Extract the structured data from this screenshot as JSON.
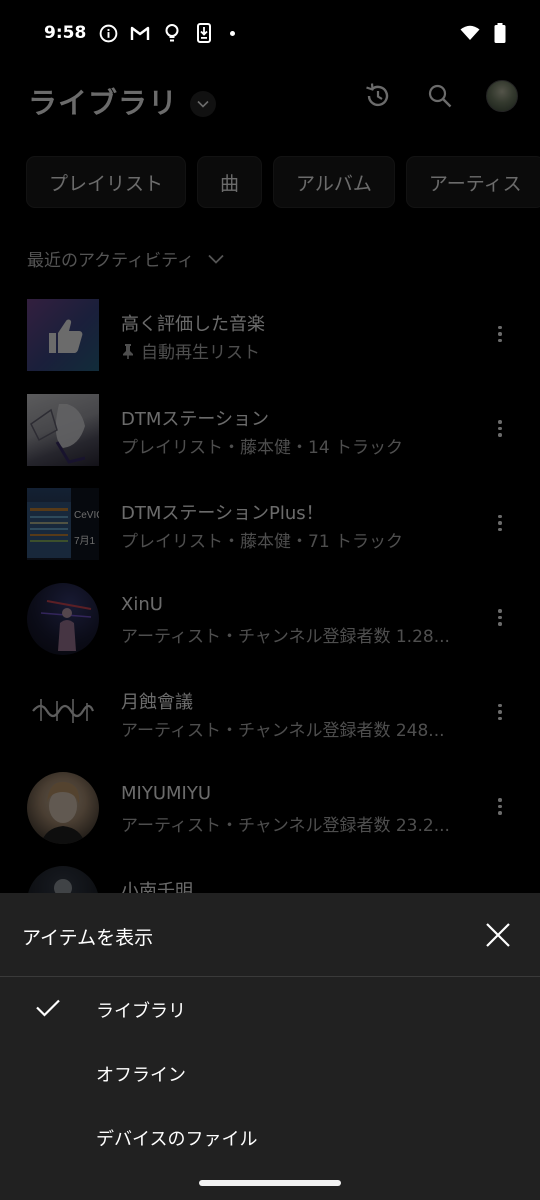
{
  "status_bar": {
    "time": "9:58",
    "icons": [
      "info-icon",
      "gmail-icon",
      "lightbulb-icon",
      "download-icon",
      "dot-icon",
      "wifi-icon",
      "battery-icon"
    ]
  },
  "header": {
    "title": "ライブラリ",
    "icons": [
      "history-icon",
      "search-icon",
      "account-avatar"
    ]
  },
  "chips": [
    "プレイリスト",
    "曲",
    "アルバム",
    "アーティス"
  ],
  "sort": {
    "label": "最近のアクティビティ"
  },
  "items": [
    {
      "title": "高く評価した音楽",
      "subtitle": "自動再生リスト",
      "thumb": "liked-thumb"
    },
    {
      "title": "DTMステーション",
      "subtitle": "プレイリスト・藤本健・14 トラック",
      "thumb": "playlist-thumb"
    },
    {
      "title": "DTMステーションPlus！",
      "subtitle": "プレイリスト・藤本健・71 トラック",
      "thumb": "playlist-thumb"
    },
    {
      "title": "XinU",
      "subtitle": "アーティスト・チャンネル登録者数 1.28...",
      "thumb": "artist-avatar"
    },
    {
      "title": "月蝕會議",
      "subtitle": "アーティスト・チャンネル登録者数 248...",
      "thumb": "artist-logo"
    },
    {
      "title": "MIYUMIYU",
      "subtitle": "アーティスト・チャンネル登録者数 23.2...",
      "thumb": "artist-avatar"
    },
    {
      "title": "小南千明",
      "subtitle": "",
      "thumb": "artist-avatar"
    }
  ],
  "sheet": {
    "title": "アイテムを表示",
    "options": [
      {
        "label": "ライブラリ",
        "selected": true
      },
      {
        "label": "オフライン",
        "selected": false
      },
      {
        "label": "デバイスのファイル",
        "selected": false
      }
    ]
  },
  "colors": {
    "background": "#000000",
    "sheet": "#212121",
    "chip": "#1c1c1c",
    "text_secondary": "#bbbbbb"
  }
}
